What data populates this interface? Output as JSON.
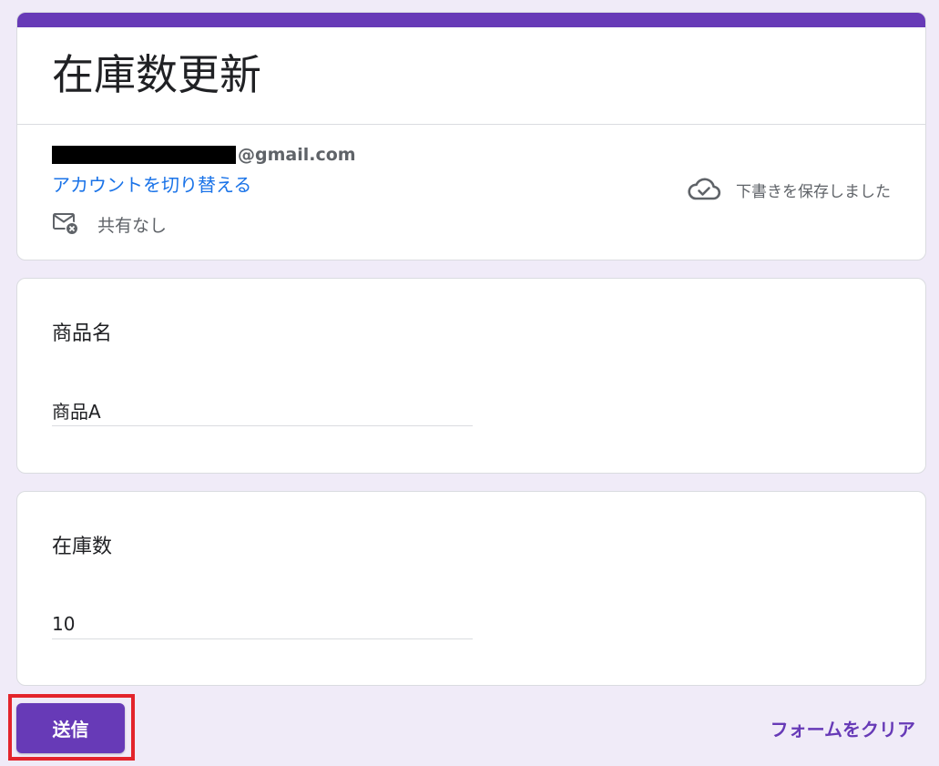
{
  "form": {
    "title": "在庫数更新",
    "accent_color": "#673ab7"
  },
  "account": {
    "email_domain": "@gmail.com",
    "switch_account_label": "アカウントを切り替える",
    "not_shared_label": "共有なし",
    "not_shared_icon": "mail-off-icon",
    "draft_saved_label": "下書きを保存しました",
    "draft_saved_icon": "cloud-done-icon"
  },
  "questions": [
    {
      "title": "商品名",
      "value": "商品A"
    },
    {
      "title": "在庫数",
      "value": "10"
    }
  ],
  "actions": {
    "submit_label": "送信",
    "clear_label": "フォームをクリア"
  },
  "colors": {
    "background": "#f0ebf8",
    "link": "#1a73e8",
    "highlight": "#e3242b"
  }
}
